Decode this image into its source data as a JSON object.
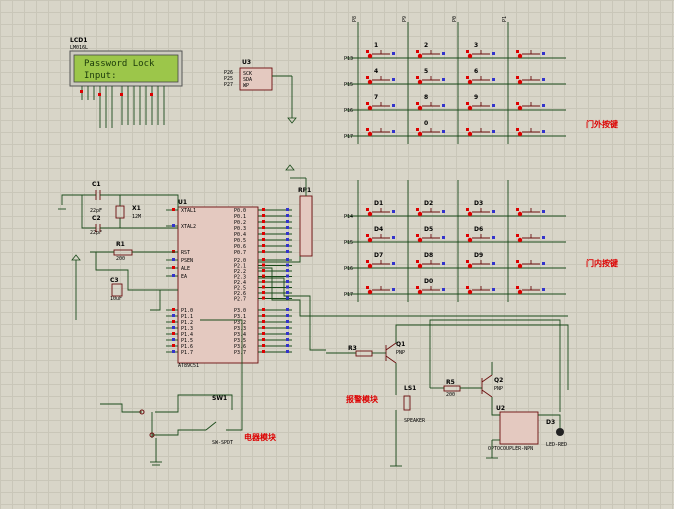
{
  "lcd": {
    "ref": "LCD1",
    "part": "LM016L",
    "line1": "Password Lock",
    "line2": "Input:"
  },
  "u3": {
    "ref": "U3",
    "pins_left": [
      "P26",
      "P25",
      "P27"
    ],
    "pins_right": [
      "SCK",
      "SDA",
      "WP"
    ]
  },
  "mcu": {
    "ref": "U1",
    "part": "AT89C51",
    "left_pins": [
      "XTAL1",
      "XTAL2",
      "RST",
      "PSEN",
      "ALE",
      "EA",
      "P1.0",
      "P1.1",
      "P1.2",
      "P1.3",
      "P1.4",
      "P1.5",
      "P1.6",
      "P1.7"
    ],
    "right_pins": [
      "P0.0/AD0",
      "P0.1/AD1",
      "P0.2/AD2",
      "P0.3/AD3",
      "P0.4/AD4",
      "P0.5/AD5",
      "P0.6/AD6",
      "P0.7/AD7",
      "P2.0/A8",
      "P2.1/A9",
      "P2.2/A10",
      "P2.3/A11",
      "P2.4/A12",
      "P2.5/A13",
      "P2.6/A14",
      "P2.7/A15",
      "P3.0/RXD",
      "P3.1/TXD",
      "P3.2/INT0",
      "P3.3/INT1",
      "P3.4/T0",
      "P3.5/T1",
      "P3.6/WR",
      "P3.7/RD"
    ]
  },
  "components": {
    "c1": "C1",
    "c1_val": "22pF",
    "c2": "C2",
    "c2_val": "22pF",
    "c3": "C3",
    "c3_val": "10uF",
    "x1": "X1",
    "x1_val": "12M",
    "r1": "R1",
    "r1_val": "200",
    "rp1": "RP1",
    "r3": "R3",
    "r5": "R5",
    "r5_val": "200",
    "q1": "Q1",
    "q1_val": "PNP",
    "q2": "Q2",
    "q2_val": "PNP",
    "ls1": "LS1",
    "ls1_val": "SPEAKER",
    "u2": "U2",
    "u2_val": "OPTOCOUPLER-NPN",
    "d3": "D3",
    "d3_val": "LED-RED",
    "sw1": "SW1",
    "sw1_val": "SW-SPDT"
  },
  "keypad_outer": {
    "title": "门外按键",
    "rows": [
      [
        "1",
        "2",
        "3",
        ""
      ],
      [
        "4",
        "5",
        "6",
        ""
      ],
      [
        "7",
        "8",
        "9",
        ""
      ],
      [
        "",
        "0",
        "",
        ""
      ]
    ],
    "row_labels": [
      "P13",
      "P15",
      "P16",
      "P17"
    ],
    "col_labels": [
      "P8",
      "P9",
      "P0",
      "P1"
    ]
  },
  "keypad_inner": {
    "title": "门内按键",
    "rows": [
      [
        "D1",
        "D2",
        "D3",
        ""
      ],
      [
        "D4",
        "D5",
        "D6",
        ""
      ],
      [
        "D7",
        "D8",
        "D9",
        ""
      ],
      [
        "",
        "D0",
        "",
        ""
      ]
    ],
    "row_labels": [
      "P14",
      "P15",
      "P16",
      "P17"
    ]
  },
  "module_labels": {
    "alarm": "报警模块",
    "motor": "电器模块"
  }
}
